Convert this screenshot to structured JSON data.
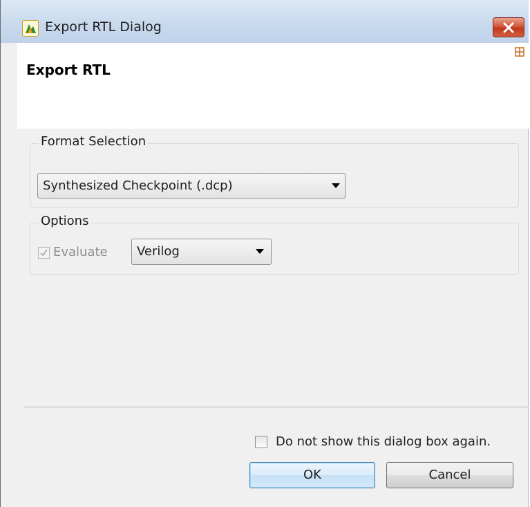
{
  "window": {
    "title": "Export RTL Dialog"
  },
  "banner": {
    "title": "Export RTL"
  },
  "format_selection": {
    "legend": "Format Selection",
    "selected": "Synthesized Checkpoint (.dcp)"
  },
  "options": {
    "legend": "Options",
    "evaluate_label": "Evaluate",
    "evaluate_checked": true,
    "evaluate_enabled": false,
    "language_selected": "Verilog"
  },
  "footer": {
    "dont_show_label": "Do not show this dialog box again.",
    "dont_show_checked": false,
    "ok_label": "OK",
    "cancel_label": "Cancel"
  },
  "colors": {
    "title_bar": "#c9daee",
    "close_button": "#c0391c",
    "ok_border": "#3c7fb1"
  },
  "icons": {
    "app": "vivado-app-icon",
    "close": "close-icon",
    "banner": "grid-icon",
    "dropdown": "dropdown-arrow-icon"
  }
}
